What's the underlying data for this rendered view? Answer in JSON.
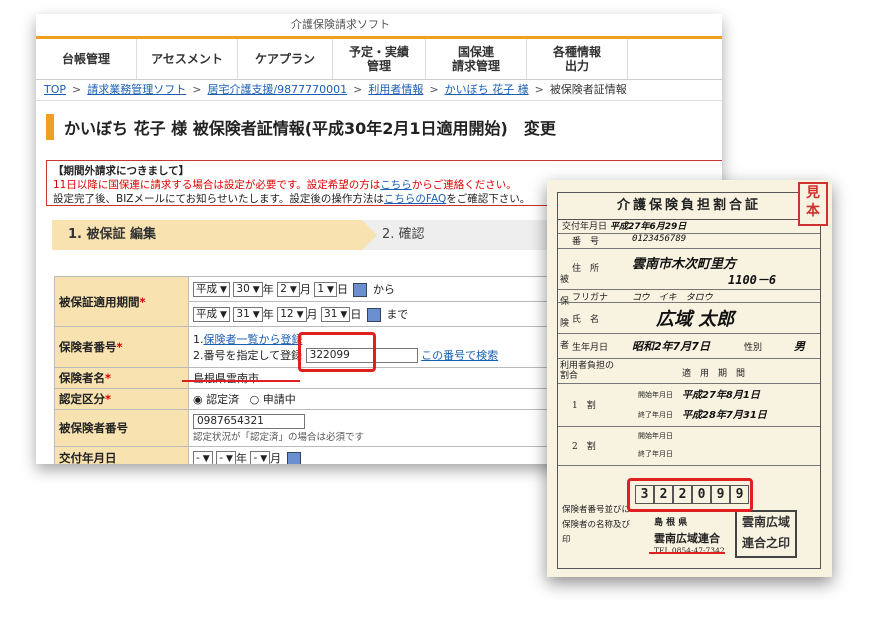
{
  "app": {
    "top_title": "介護保険請求ソフト"
  },
  "nav": {
    "items": [
      "台帳管理",
      "アセスメント",
      "ケアプラン",
      "予定・実績\n管理",
      "国保連\n請求管理",
      "各種情報\n出力"
    ]
  },
  "breadcrumb": {
    "items": [
      "TOP",
      "請求業務管理ソフト",
      "居宅介護支援/9877770001",
      "利用者情報",
      "かいぼち 花子 様"
    ],
    "current": "被保険者証情報",
    "sep": ">"
  },
  "page_title": "かいぼち 花子 様 被保険者証情報(平成30年2月1日適用開始)　変更",
  "notice": {
    "title": "【期間外請求につきまして】",
    "line1_pre": "11日以降に国保連に請求する場合は設定が必要です。設定希望の方は",
    "line1_link": "こちら",
    "line1_post": "からご連絡ください。",
    "line2_pre": "設定完了後、BIZメールにてお知らせいたします。設定後の操作方法は",
    "line2_link": "こちらのFAQ",
    "line2_post": "をご確認下さい。"
  },
  "steps": {
    "step1": "1. 被保証 編集",
    "step2": "2. 確認"
  },
  "form": {
    "period": {
      "label": "被保証適用期間",
      "required": "*",
      "row1": {
        "era": "平成",
        "year": "30",
        "month": "2",
        "day": "1",
        "suffix": "から"
      },
      "row2": {
        "era": "平成",
        "year": "31",
        "month": "12",
        "day": "31",
        "suffix": "まで"
      },
      "year_unit": "年",
      "month_unit": "月",
      "day_unit": "日"
    },
    "insurer_no": {
      "label": "保険者番号",
      "required": "*",
      "opt1_prefix": "1.",
      "opt1_link": "保険者一覧から登録",
      "opt2_prefix": "2.番号を指定して登録",
      "value": "322099",
      "search_link": "この番号で検索"
    },
    "insurer_name": {
      "label": "保険者名",
      "required": "*",
      "value": "島根県雲南市"
    },
    "cert_status": {
      "label": "認定区分",
      "required": "*",
      "opt1": "認定済",
      "opt2": "申請中"
    },
    "insured_no": {
      "label": "被保険者番号",
      "value": "0987654321",
      "note": "認定状況が「認定済」の場合は必須です"
    },
    "issue_date": {
      "label": "交付年月日",
      "era": "-",
      "month": "-",
      "day": "-"
    }
  },
  "card": {
    "stamp": "見本",
    "title": "介護保険負担割合証",
    "issue_label": "交付年月日",
    "issue_value": "平成27年6月29日",
    "number_label": "番　号",
    "number_value": "0123456789",
    "side_label": "被保険者",
    "address_label": "住　所",
    "address_value1": "雲南市木次町里方",
    "address_value2": "1100－6",
    "furigana_label": "フリガナ",
    "furigana_value": "コウ　イキ　タロウ",
    "name_label": "氏　名",
    "name_value": "広域 太郎",
    "dob_label": "生年月日",
    "dob_value": "昭和2年7月7日",
    "gender_label": "性別",
    "gender_value": "男",
    "ratio_header": "利用者負担の割合",
    "period_header": "適　用　期　間",
    "r1": "1　割",
    "r1_start_label": "開始年月日",
    "r1_start": "平成27年8月1日",
    "r1_end_label": "終了年月日",
    "r1_end": "平成28年7月31日",
    "r2": "2　割",
    "r2_start_label": "開始年月日",
    "r2_end_label": "終了年月日",
    "insurer_label": "保険者番号並びに保険者の名称及び印",
    "insurer_digits": [
      "3",
      "2",
      "2",
      "0",
      "9",
      "9"
    ],
    "insurer_pref": "島 根 県",
    "insurer_name": "雲南広域連合",
    "insurer_tel": "TEL 0854-47-7342",
    "seal_text": "雲南広域連合之印"
  }
}
